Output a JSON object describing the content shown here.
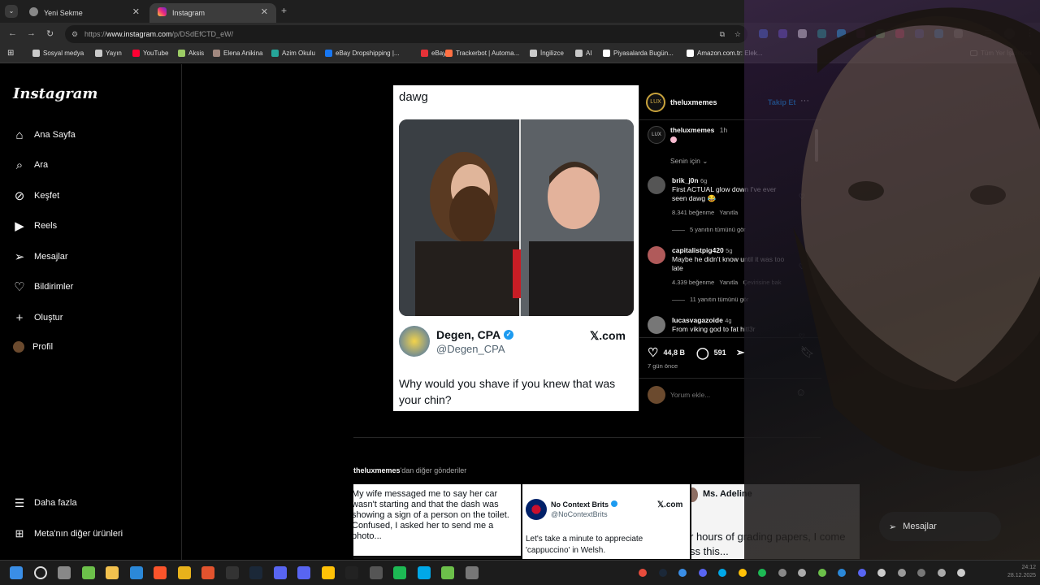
{
  "browser": {
    "tabs": [
      {
        "label": "Yeni Sekme",
        "active": false
      },
      {
        "label": "Instagram",
        "active": true
      }
    ],
    "new_tab": "+",
    "url_prefix": "https://",
    "url_host": "www.instagram.com",
    "url_path": "/p/DSdEfCTD_eW/",
    "bookmarks": [
      {
        "label": "Sosyal medya",
        "color": "#c9c9c9"
      },
      {
        "label": "Yayın",
        "color": "#c9c9c9"
      },
      {
        "label": "YouTube",
        "color": "#ff0033"
      },
      {
        "label": "Aksis",
        "color": "#9ccc65"
      },
      {
        "label": "Elena Anikina",
        "color": "#a1887f"
      },
      {
        "label": "Azim Okulu",
        "color": "#26a69a"
      },
      {
        "label": "eBay Dropshipping |...",
        "color": "#1877f2"
      },
      {
        "label": "eBay",
        "color": "#e53238"
      },
      {
        "label": "Trackerbot | Automa...",
        "color": "#ff7043"
      },
      {
        "label": "İngilizce",
        "color": "#c9c9c9"
      },
      {
        "label": "AI",
        "color": "#c9c9c9"
      },
      {
        "label": "Piyasalarda Bugün...",
        "color": "#ffffff"
      },
      {
        "label": "Amazon.com.tr: Elek...",
        "color": "#ffffff"
      }
    ],
    "bookmarks_all": "Tüm Yer İşaretleri"
  },
  "instagram": {
    "logo": "Instagram",
    "nav": [
      {
        "label": "Ana Sayfa",
        "icon": "home-icon"
      },
      {
        "label": "Ara",
        "icon": "search-icon"
      },
      {
        "label": "Keşfet",
        "icon": "compass-icon"
      },
      {
        "label": "Reels",
        "icon": "reels-icon"
      },
      {
        "label": "Mesajlar",
        "icon": "messages-icon"
      },
      {
        "label": "Bildirimler",
        "icon": "heart-icon"
      },
      {
        "label": "Oluştur",
        "icon": "plus-icon"
      },
      {
        "label": "Profil",
        "icon": "avatar"
      }
    ],
    "more": "Daha fazla",
    "meta": "Meta'nın diğer ürünleri"
  },
  "post": {
    "top_text": "dawg",
    "tweet_name": "Degen, CPA",
    "tweet_handle": "@Degen_CPA",
    "tweet_site": "𝕏.com",
    "tweet_text": "Why would you shave if you knew that was your chin?",
    "author": "theluxmemes",
    "follow": "Takip Et",
    "more_dots": "···",
    "caption_user": "theluxmemes",
    "caption_time": "1h",
    "sort": "Senin için",
    "comments": [
      {
        "user": "brik_j0n",
        "time": "6g",
        "text": "First ACTUAL glow down I've ever seen dawg 😂",
        "likes": "8.341 beğenme",
        "reply": "Yanıtla",
        "translate": "",
        "view_replies": "5 yanıtın tümünü gör"
      },
      {
        "user": "capitalistpig420",
        "time": "5g",
        "text": "Maybe he didn't know until it was too late",
        "likes": "4.339 beğenme",
        "reply": "Yanıtla",
        "translate": "Çevirisine bak",
        "view_replies": "11 yanıtın tümünü gör"
      },
      {
        "user": "lucasvagazoide",
        "time": "4g",
        "text": "From viking god to fat hitl3r",
        "likes": "",
        "reply": "",
        "translate": "",
        "view_replies": ""
      }
    ],
    "like_count": "44,8 B",
    "comment_count": "591",
    "date": "7 gün önce",
    "comment_placeholder": "Yorum ekle..."
  },
  "more_posts": {
    "heading_user": "theluxmemes",
    "heading_rest": "'dan diğer gönderiler",
    "cells": [
      {
        "text": "My wife messaged me to say her car wasn't starting and that the dash was showing a sign of a person on the toilet. Confused, I asked her to send me a photo..."
      },
      {
        "name": "No Context Brits",
        "handle": "@NoContextBrits",
        "site": "𝕏.com",
        "text": "Let's take a minute to appreciate 'cappuccino' in Welsh."
      },
      {
        "name": "Ms. Adeline",
        "text": "r hours of grading papers, I come ss this..."
      }
    ],
    "messages_button": "Mesajlar"
  },
  "colors": {
    "instagram_bg": "#000000",
    "accent_blue": "#0095f6",
    "verified": "#1d9bf0"
  },
  "taskbar": {
    "clock_time": "24:12",
    "clock_date": "28.12.2025"
  }
}
